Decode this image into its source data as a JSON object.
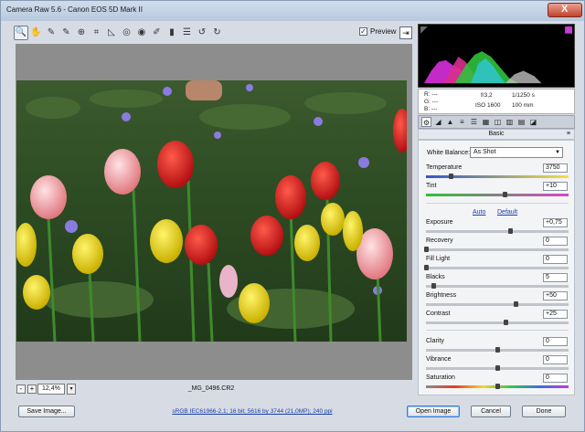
{
  "window": {
    "title": "Camera Raw 5.6  -  Canon EOS 5D Mark II",
    "close_label": "X"
  },
  "toolbar": {
    "tools": [
      {
        "name": "zoom-tool",
        "glyph": "🔍"
      },
      {
        "name": "hand-tool",
        "glyph": "✋"
      },
      {
        "name": "white-balance-tool",
        "glyph": "✎"
      },
      {
        "name": "color-sampler-tool",
        "glyph": "✎"
      },
      {
        "name": "targeted-adjustment-tool",
        "glyph": "⊕"
      },
      {
        "name": "crop-tool",
        "glyph": "⌗"
      },
      {
        "name": "straighten-tool",
        "glyph": "◺"
      },
      {
        "name": "spot-removal-tool",
        "glyph": "◎"
      },
      {
        "name": "red-eye-tool",
        "glyph": "◉"
      },
      {
        "name": "adjustment-brush-tool",
        "glyph": "✐"
      },
      {
        "name": "graduated-filter-tool",
        "glyph": "▮"
      },
      {
        "name": "preferences-tool",
        "glyph": "☰"
      },
      {
        "name": "rotate-ccw-tool",
        "glyph": "↺"
      },
      {
        "name": "rotate-cw-tool",
        "glyph": "↻"
      }
    ],
    "preview_label": "Preview",
    "preview_checked": "✓",
    "fullscreen_glyph": "⇥"
  },
  "canvas": {
    "zoom_minus": "-",
    "zoom_plus": "+",
    "zoom_value": "12,4%",
    "zoom_arrow": "▾",
    "filename": "_MG_0496.CR2"
  },
  "readout": {
    "r": "R:   ---",
    "g": "G:   ---",
    "b": "B:   ---",
    "aperture": "f/3,2",
    "shutter": "1/1250 s",
    "iso": "ISO 1600",
    "focal": "100 mm"
  },
  "tabs": [
    "⚙",
    "◢",
    "▲",
    "≡",
    "☰",
    "▦",
    "◫",
    "▥",
    "▤",
    "◪"
  ],
  "panel": {
    "title": "Basic",
    "menu_glyph": "≡",
    "white_balance_label": "White Balance:",
    "white_balance_value": "As Shot",
    "auto_label": "Auto",
    "default_label": "Default",
    "sliders": [
      {
        "name": "temperature",
        "label": "Temperature",
        "value": "3750",
        "position": 0.17,
        "track": "linear-gradient(90deg,#2f56c8,#f2e04a)"
      },
      {
        "name": "tint",
        "label": "Tint",
        "value": "+10",
        "position": 0.55,
        "track": "linear-gradient(90deg,#2fbf3a,#d944c8)"
      },
      {
        "name": "exposure",
        "label": "Exposure",
        "value": "+0,75",
        "position": 0.59,
        "track": "#bfc4cb"
      },
      {
        "name": "recovery",
        "label": "Recovery",
        "value": "0",
        "position": 0.0,
        "track": "#bfc4cb"
      },
      {
        "name": "fill-light",
        "label": "Fill Light",
        "value": "0",
        "position": 0.0,
        "track": "#bfc4cb"
      },
      {
        "name": "blacks",
        "label": "Blacks",
        "value": "5",
        "position": 0.05,
        "track": "#bfc4cb"
      },
      {
        "name": "brightness",
        "label": "Brightness",
        "value": "+50",
        "position": 0.63,
        "track": "#bfc4cb"
      },
      {
        "name": "contrast",
        "label": "Contrast",
        "value": "+25",
        "position": 0.56,
        "track": "#bfc4cb"
      },
      {
        "name": "clarity",
        "label": "Clarity",
        "value": "0",
        "position": 0.5,
        "track": "#bfc4cb"
      },
      {
        "name": "vibrance",
        "label": "Vibrance",
        "value": "0",
        "position": 0.5,
        "track": "#bfc4cb"
      },
      {
        "name": "saturation",
        "label": "Saturation",
        "value": "0",
        "position": 0.5,
        "track": "linear-gradient(90deg,#8a8a8a,#e23c2c,#f2d23a,#3ac24a,#3a6ee2,#c43ad2)"
      }
    ]
  },
  "footer": {
    "save_label": "Save Image...",
    "workflow_label": "sRGB IEC61966-2.1; 16 bit; 5616 by 3744 (21,0MP); 240 ppi",
    "open_label": "Open Image",
    "cancel_label": "Cancel",
    "done_label": "Done"
  },
  "colors": {
    "accent": "#3b7bd1",
    "link": "#1b3fa6",
    "canvas_bg": "#8d8d8d"
  }
}
